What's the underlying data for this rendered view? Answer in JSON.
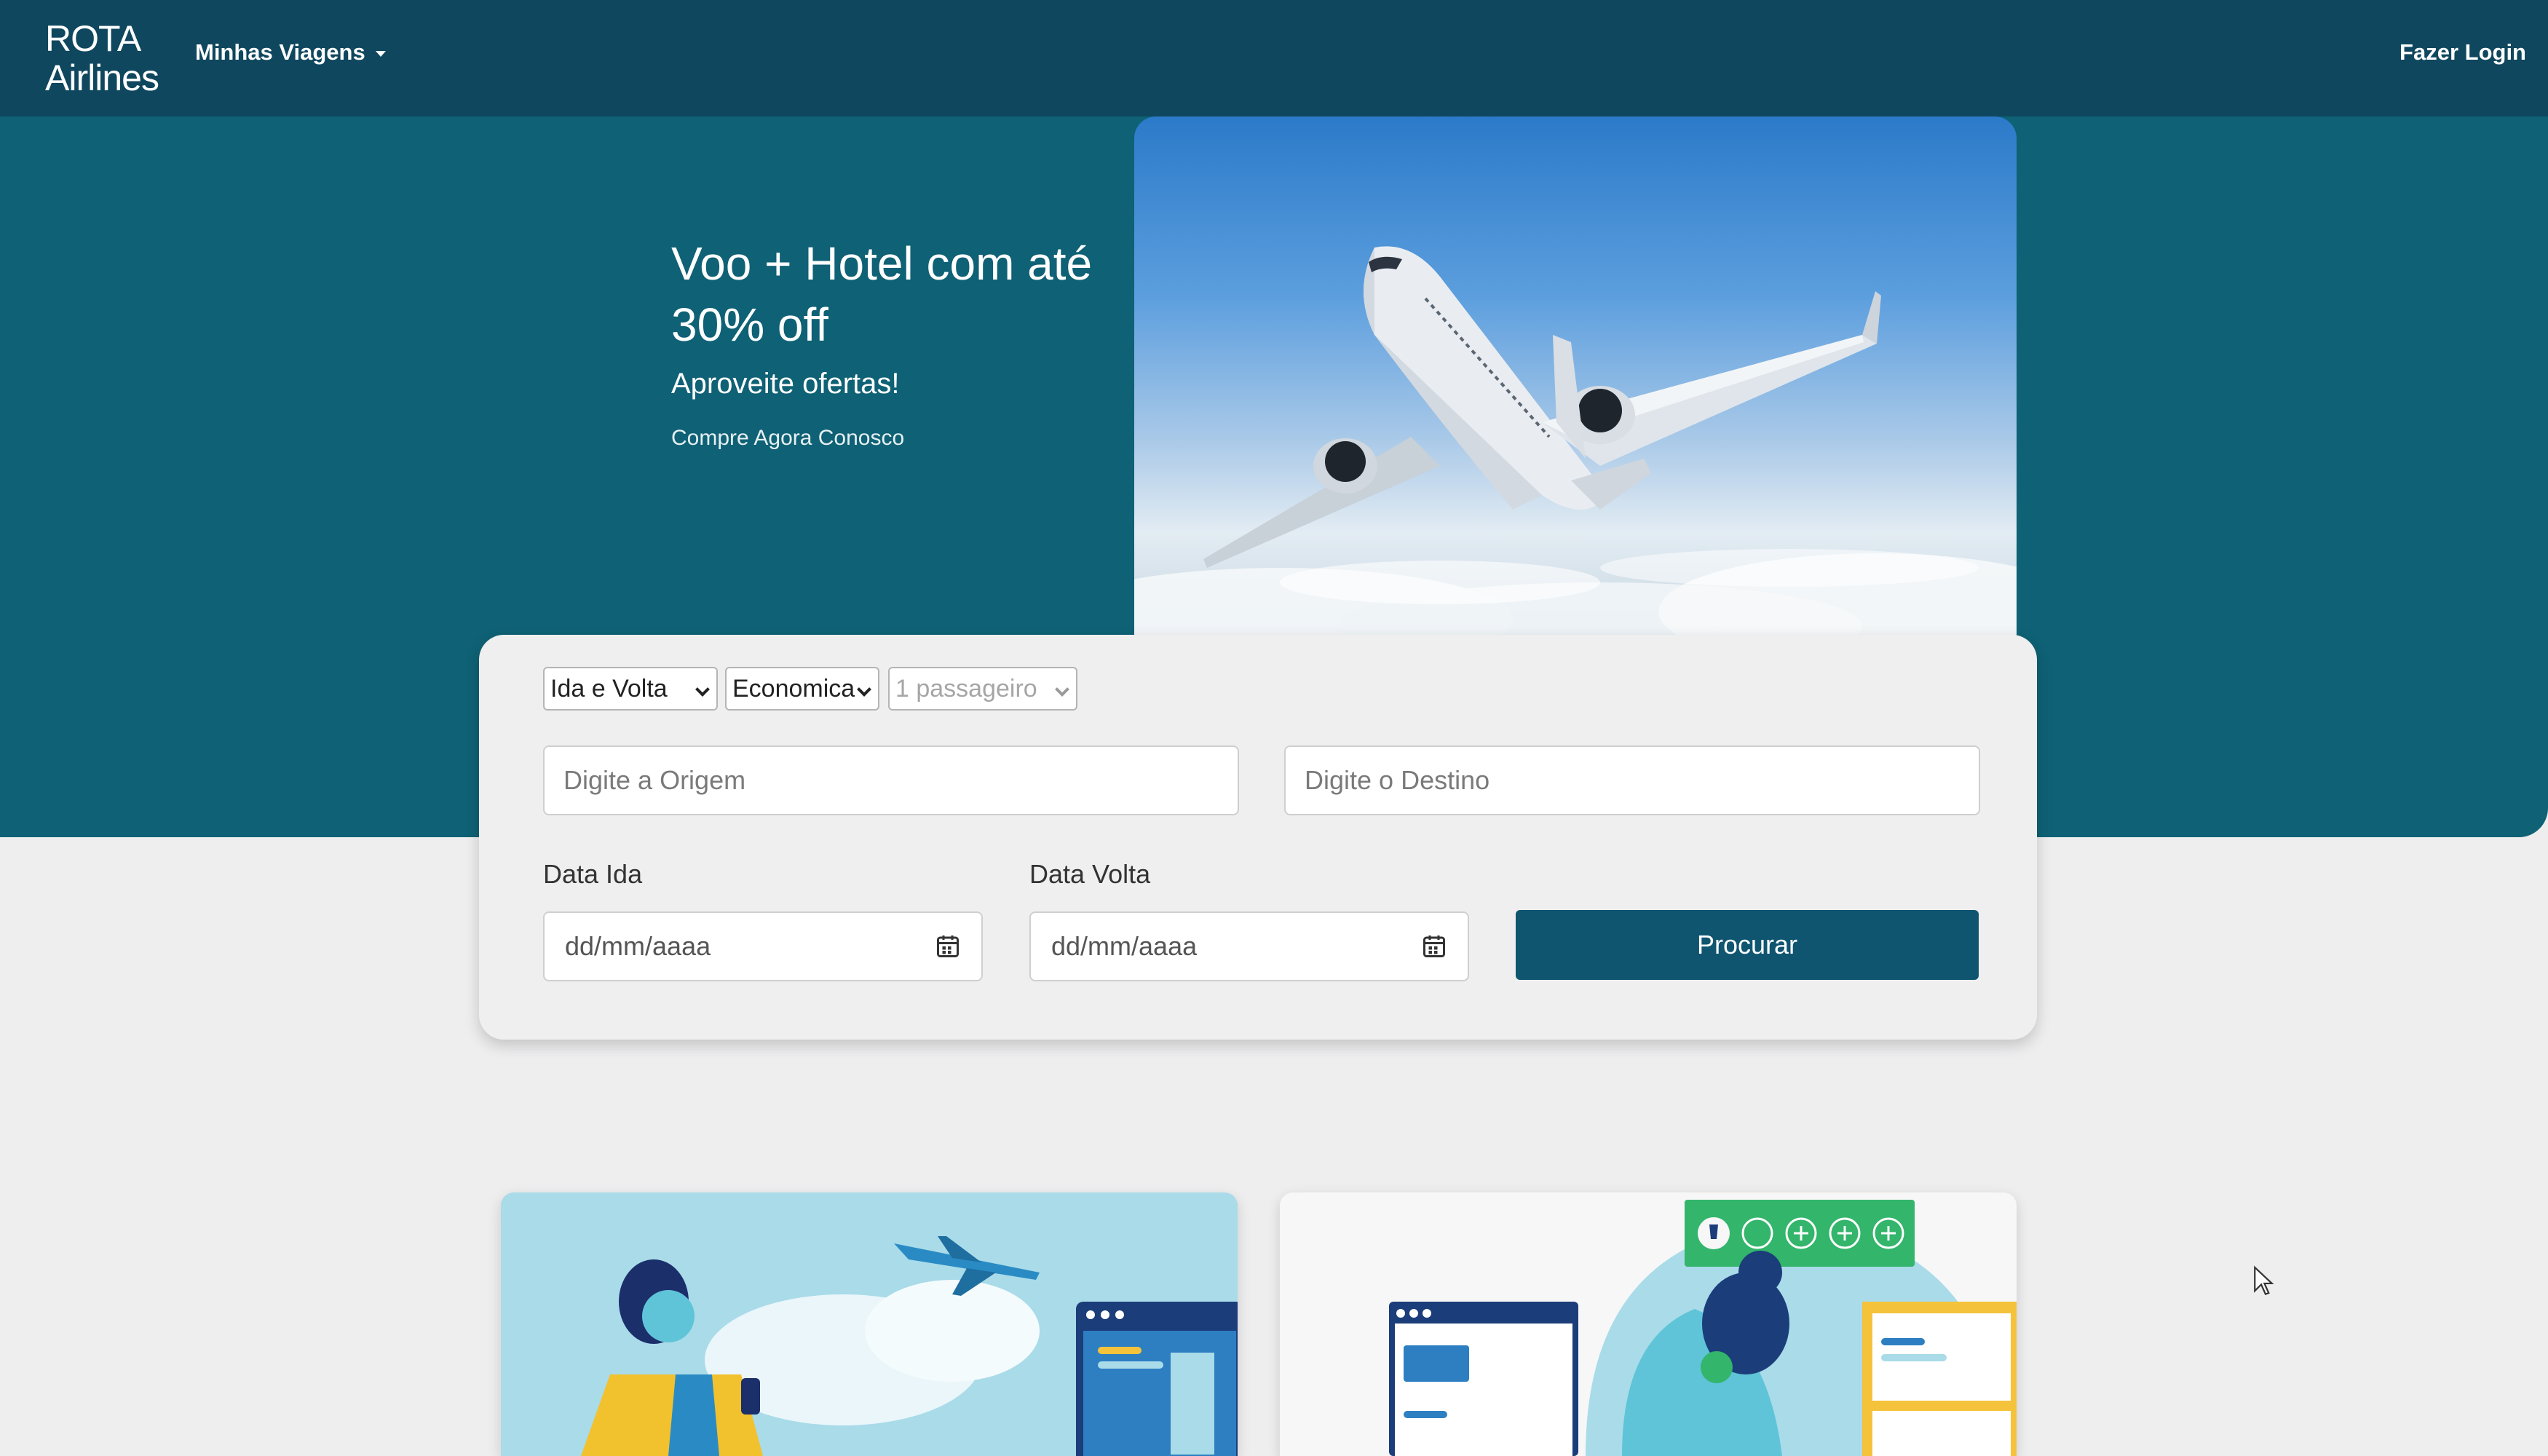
{
  "navbar": {
    "brand_line1": "ROTA",
    "brand_line2": "Airlines",
    "menu_label": "Minhas Viagens",
    "login_label": "Fazer Login"
  },
  "hero": {
    "title": "Voo + Hotel com até 30% off",
    "subtitle": "Aproveite ofertas!",
    "small_text": "Compre Agora Conosco"
  },
  "search": {
    "trip_type": "Ida e Volta",
    "cabin_class": "Economica",
    "passengers": "1 passageiro",
    "origin_placeholder": "Digite a Origem",
    "destination_placeholder": "Digite o Destino",
    "date_out_label": "Data Ida",
    "date_return_label": "Data Volta",
    "date_out_placeholder": "dd/mm/aaaa",
    "date_return_placeholder": "dd/mm/aaaa",
    "submit_label": "Procurar"
  },
  "colors": {
    "navbar": "#0f475e",
    "hero": "#0f6175",
    "button": "#0f5570",
    "page_bg": "#eeeeef"
  },
  "icons": [
    "caret-down-icon",
    "calendar-icon",
    "mouse-cursor-icon"
  ]
}
